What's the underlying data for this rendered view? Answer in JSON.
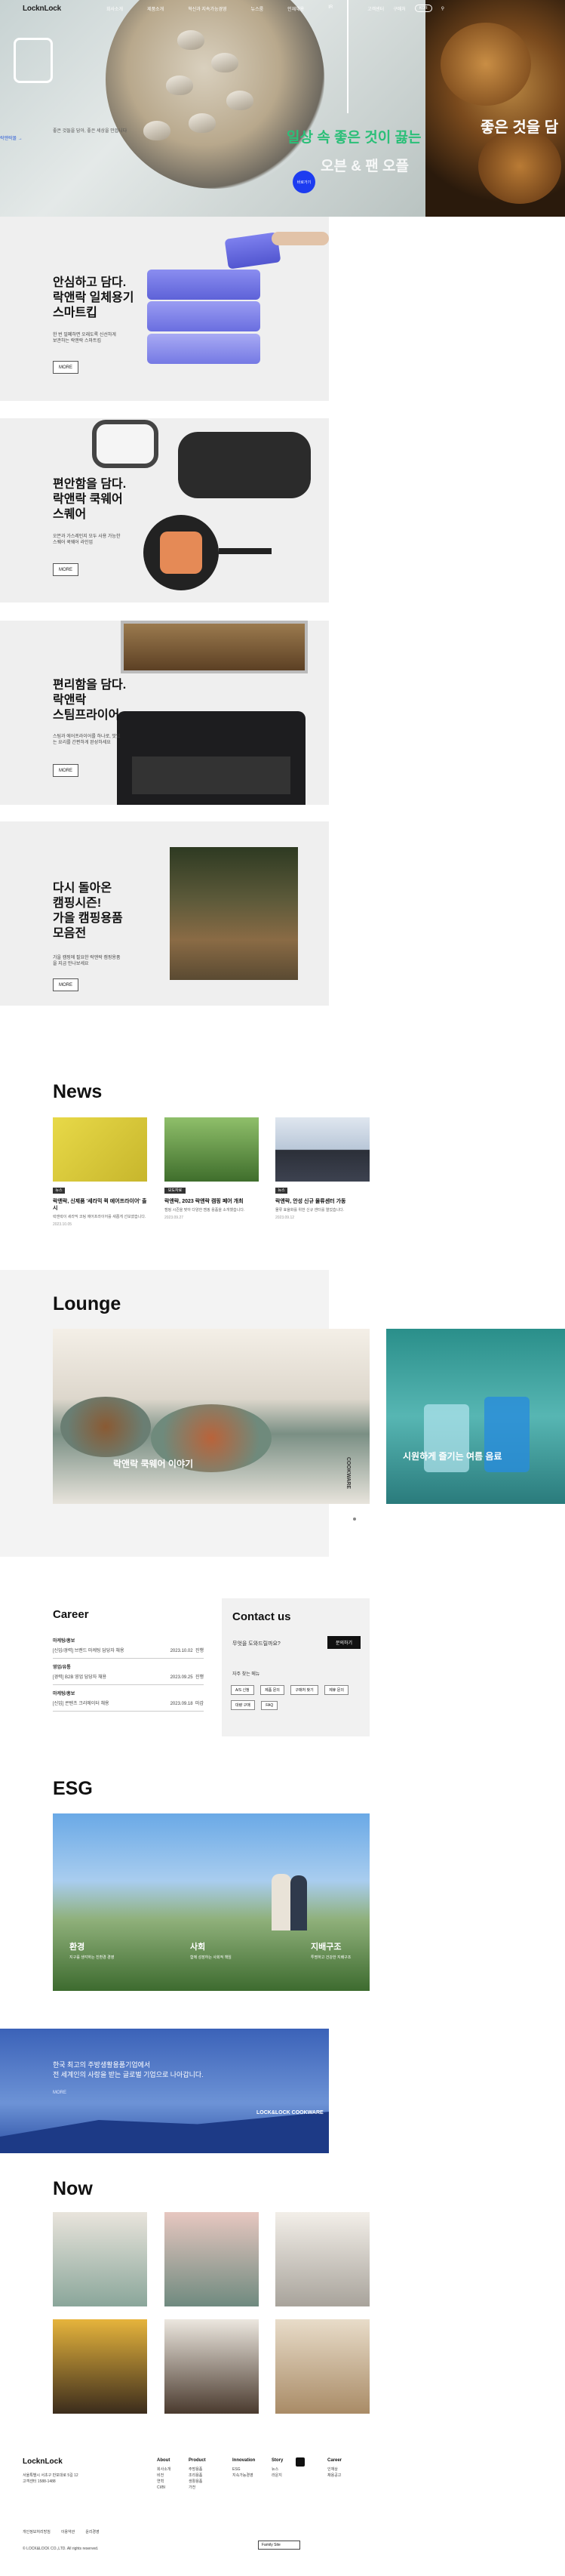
{
  "header": {
    "logo": "LocknLock",
    "nav": [
      "회사소개",
      "제품소개",
      "혁신과 지속가능경영",
      "뉴스룸",
      "인재채용",
      "IR"
    ],
    "util": [
      "고객센터",
      "구매처"
    ],
    "lang": "KOR"
  },
  "hero": {
    "subtitle": "좋은 것들을 담아, 좋은 세상을 만듭니다",
    "left_link": "락앤락몰 →",
    "tagline1": "일상 속 좋은 것이 끓는",
    "tagline2": "오븐 & 팬 오플",
    "button": "바로가기",
    "side_text": "좋은 것을 담"
  },
  "products": [
    {
      "title": [
        "안심하고 담다.",
        "락앤락 일체용기",
        "스마트킵"
      ],
      "desc": "한 번 밀폐하면 오래도록 신선하게 보관하는 락앤락 스마트킵",
      "more": "MORE"
    },
    {
      "title": [
        "편안함을 담다.",
        "락앤락 쿡웨어",
        "스퀘어"
      ],
      "desc": "오븐과 가스레인지 모두 사용 가능한 스퀘어 쿡웨어 라인업",
      "more": "MORE"
    },
    {
      "title": [
        "편리함을 담다.",
        "락앤락",
        "스팀프라이어"
      ],
      "desc": "스팀과 에어프라이어를 하나로, 맛있는 요리를 간편하게 완성하세요",
      "more": "MORE"
    },
    {
      "title": [
        "다시 돌아온",
        "캠핑시즌!",
        "가을 캠핑용품",
        "모음전"
      ],
      "desc": "가을 캠핑에 필요한 락앤락 캠핑용품을 지금 만나보세요",
      "more": "MORE"
    }
  ],
  "news": {
    "heading": "News",
    "items": [
      {
        "tag": "뉴스",
        "title": "락앤락, 신제품 '세라믹 퀵 에어프라이어' 출시",
        "desc": "락앤락이 세라믹 코팅 에어프라이어를 새롭게 선보였습니다.",
        "date": "2023.10.05"
      },
      {
        "tag": "보도자료",
        "title": "락앤락, 2023 락앤락 캠핑 페어 개최",
        "desc": "캠핑 시즌을 맞아 다양한 캠핑 용품을 소개했습니다.",
        "date": "2023.09.27"
      },
      {
        "tag": "뉴스",
        "title": "락앤락, 안성 신규 물류센터 가동",
        "desc": "물류 효율화를 위한 신규 센터를 열었습니다.",
        "date": "2023.09.12"
      }
    ]
  },
  "lounge": {
    "heading": "Lounge",
    "card1": "락앤락 쿡웨어 이야기",
    "card1_side": "COOKWARE",
    "card2": "시원하게 즐기는 여름 음료"
  },
  "career": {
    "heading": "Career",
    "items": [
      {
        "category": "마케팅/홍보",
        "title": "[신입/경력] 브랜드 마케팅 담당자 채용",
        "date": "2023.10.02",
        "status": "진행"
      },
      {
        "category": "영업/유통",
        "title": "[경력] B2B 영업 담당자 채용",
        "date": "2023.09.25",
        "status": "진행"
      },
      {
        "category": "마케팅/홍보",
        "title": "[신입] 콘텐츠 크리에이터 채용",
        "date": "2023.09.18",
        "status": "마감"
      }
    ]
  },
  "contact": {
    "heading": "Contact us",
    "question": "무엇을 도와드릴까요?",
    "button": "문의하기",
    "sub": "자주 찾는 메뉴",
    "chips": [
      "A/S 신청",
      "제품 문의",
      "구매처 찾기",
      "제휴 문의",
      "대량 구매",
      "FAQ"
    ]
  },
  "esg": {
    "heading": "ESG",
    "items": [
      {
        "label": "환경",
        "desc": "지구를 생각하는 친환경 경영"
      },
      {
        "label": "사회",
        "desc": "함께 성장하는 사회적 책임"
      },
      {
        "label": "지배구조",
        "desc": "투명하고 건강한 지배구조"
      }
    ]
  },
  "banner": {
    "text1": "한국 최고의 주방생활용품기업에서",
    "text2": "전 세계인의 사랑을 받는 글로벌 기업으로 나아갑니다.",
    "more": "MORE",
    "building_sign": "LOCK&LOCK COOKWARE"
  },
  "now": {
    "heading": "Now"
  },
  "footer": {
    "logo": "LocknLock",
    "address": "서울특별시 서초구 반포대로 5길 12",
    "tel": "고객센터 1588-1488",
    "copyright": "© LOCK&LOCK CO.,LTD. All rights reserved.",
    "cols": [
      {
        "head": "About",
        "items": [
          "회사소개",
          "비전",
          "연혁",
          "CI/BI"
        ]
      },
      {
        "head": "Product",
        "items": [
          "주방용품",
          "조리용품",
          "생활용품",
          "가전"
        ]
      },
      {
        "head": "Innovation",
        "items": [
          "ESG",
          "지속가능경영"
        ]
      },
      {
        "head": "Story",
        "items": [
          "뉴스",
          "라운지"
        ]
      },
      {
        "head": "Career",
        "items": [
          "인재상",
          "채용공고"
        ]
      }
    ],
    "links": [
      "개인정보처리방침",
      "이용약관",
      "윤리경영"
    ],
    "family_site": "Family Site"
  }
}
